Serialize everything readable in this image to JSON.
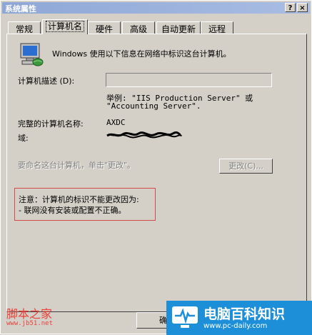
{
  "window": {
    "title": "系统属性",
    "help_glyph": "?",
    "close_glyph": "×"
  },
  "tabs": [
    {
      "label": "常规"
    },
    {
      "label": "计算机名",
      "active": true
    },
    {
      "label": "硬件"
    },
    {
      "label": "高级"
    },
    {
      "label": "自动更新"
    },
    {
      "label": "远程"
    }
  ],
  "main": {
    "intro": "Windows 使用以下信息在网络中标识这台计算机。",
    "desc_label": "计算机描述 (D):",
    "desc_value": "",
    "example_line1": "举例: \"IIS Production Server\" 或",
    "example_line2": "\"Accounting Server\".",
    "full_name_label": "完整的计算机名称:",
    "full_name_value": "AXDC",
    "domain_label": "域:",
    "rename_text": "要命名这台计算机，单击\"更改\"。",
    "change_button": "更改(C)...",
    "note_line1": "注意：计算机的标识不能更改因为:",
    "note_line2": "- 联网没有安装或配置不正确。",
    "ok_button": "确"
  },
  "watermarks": {
    "left_title": "脚本之家",
    "left_url": "www.jb51.net",
    "right_title": "电脑百科知识",
    "right_url": "www.pc-daily.com"
  },
  "colors": {
    "titlebar": "#8ea7d6",
    "note_border": "#d24a4a",
    "watermark_red": "#e8413a",
    "watermark_blue": "#1d8fd8"
  }
}
